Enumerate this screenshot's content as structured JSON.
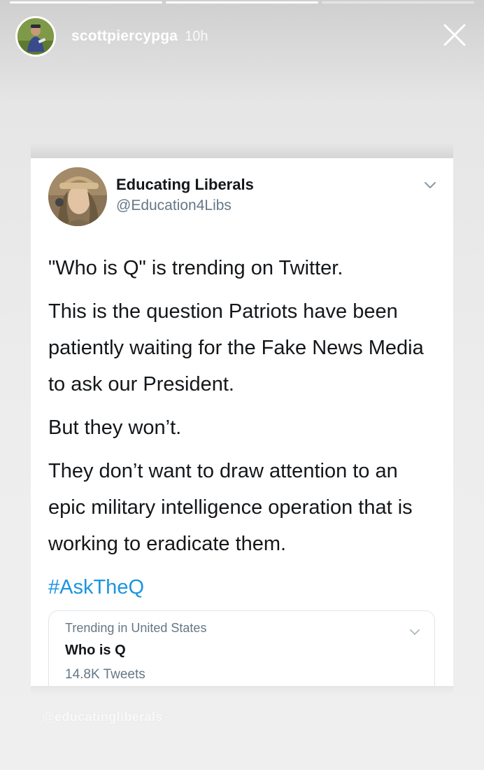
{
  "story": {
    "progress": [
      1,
      1,
      0
    ],
    "username": "scottpiercypga",
    "time": "10h"
  },
  "tweet": {
    "display_name": "Educating Liberals",
    "handle": "@Education4Libs",
    "paragraphs": [
      "\"Who is Q\" is trending on Twitter.",
      "This is the question Patriots have been patiently waiting for the Fake News Media to ask our President.",
      "But they won’t.",
      "They don’t want to draw attention to an epic military intelligence operation that is working to eradicate them."
    ],
    "hashtag": "#AskTheQ",
    "trend": {
      "label": "Trending in United States",
      "title": "Who is Q",
      "count": "14.8K Tweets"
    }
  },
  "watermark": "@educatingliberals",
  "colors": {
    "link": "#1b95e0",
    "text": "#14171a",
    "muted": "#657786"
  },
  "icons": {
    "close": "close-icon",
    "chevron": "chevron-down-icon"
  }
}
